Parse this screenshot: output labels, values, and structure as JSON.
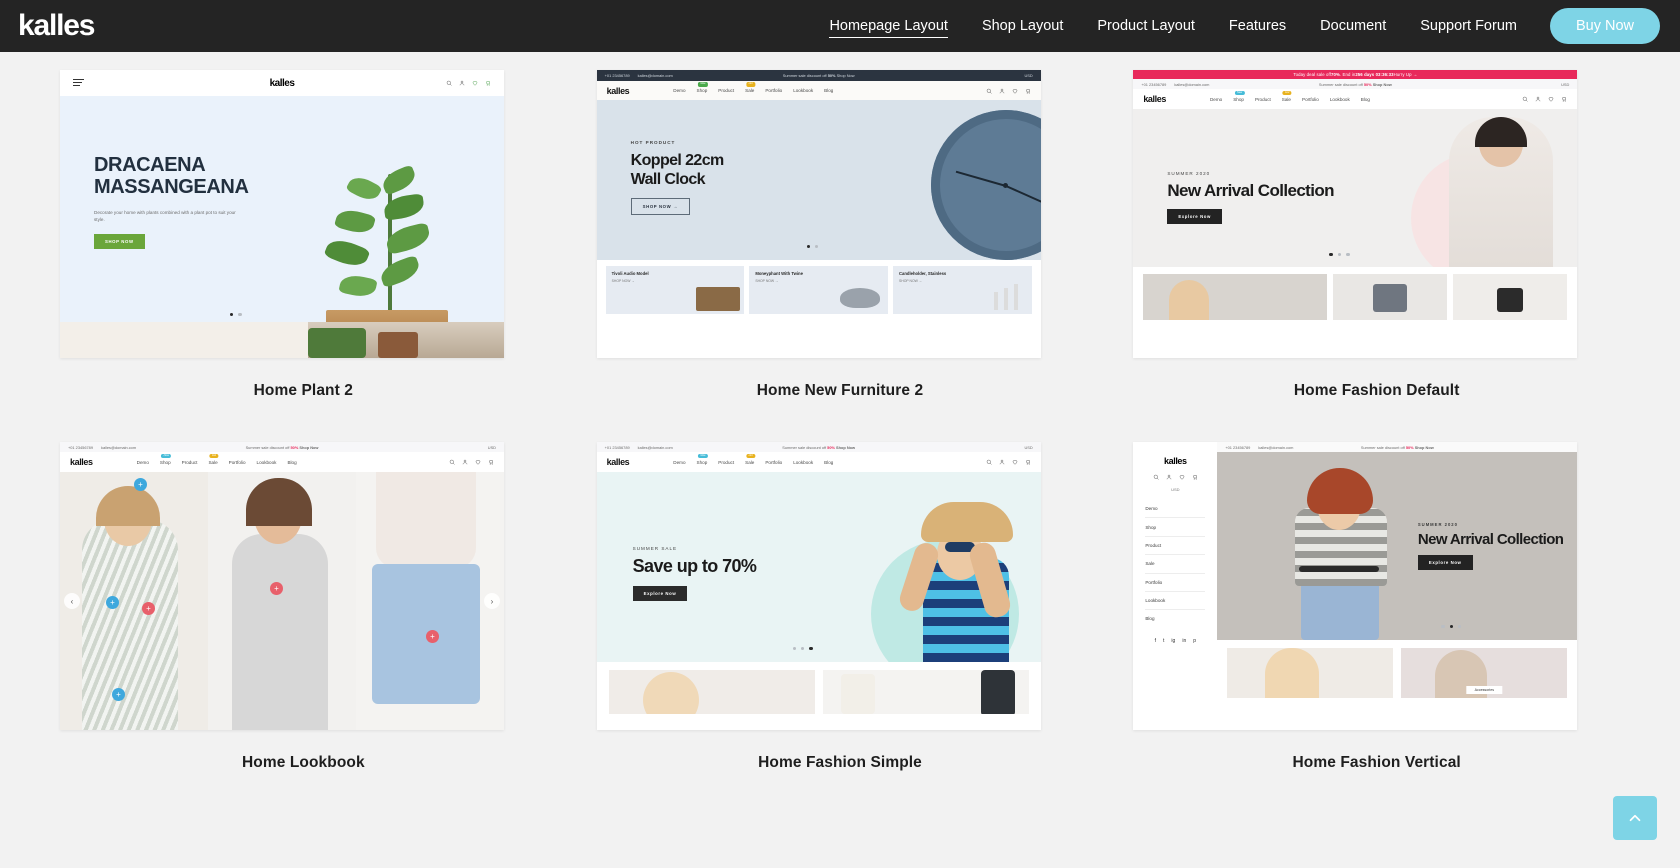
{
  "header": {
    "brand": "kalles",
    "nav": [
      {
        "label": "Homepage Layout",
        "active": true
      },
      {
        "label": "Shop Layout",
        "active": false
      },
      {
        "label": "Product Layout",
        "active": false
      },
      {
        "label": "Features",
        "active": false
      },
      {
        "label": "Document",
        "active": false
      },
      {
        "label": "Support Forum",
        "active": false
      }
    ],
    "cta": "Buy Now",
    "accent_color": "#7ed4e6",
    "bar_color": "#242424"
  },
  "common": {
    "logo": "kalles",
    "phone": "+01 23456789",
    "email": "kalles@domain.com",
    "announcement_prefix": "Summer sale discount off ",
    "announcement_percent": "50%",
    "announcement_suffix": " Shop Now",
    "currency": "USD",
    "nav_items": [
      "Demo",
      "Shop",
      "Product",
      "Sale",
      "Portfolio",
      "Lookbook",
      "Blog"
    ],
    "badge_new": "New",
    "badge_hot": "Hot",
    "social": [
      "f",
      "t",
      "ig",
      "in",
      "p"
    ]
  },
  "cards": [
    {
      "id": "home-plant-2",
      "title": "Home Plant 2",
      "hero": {
        "title_line1": "DRACAENA",
        "title_line2": "MASSANGEANA",
        "subtitle": "Decorate your home with plants combined with a plant pot to suit your style.",
        "button": "SHOP NOW",
        "button_color": "#6aa63a",
        "bg": "#eaf2fb"
      },
      "dots": {
        "count": 2,
        "active": 0
      }
    },
    {
      "id": "home-new-furniture-2",
      "title": "Home New Furniture 2",
      "hero": {
        "eyebrow": "HOT PRODUCT",
        "title_line1": "Koppel 22cm",
        "title_line2": "Wall Clock",
        "button": "SHOP NOW  →",
        "bg": "#d9e2ea"
      },
      "dots": {
        "count": 2,
        "active": 0
      },
      "products": [
        {
          "name": "Tivoli Audio Model",
          "button": "SHOP NOW  →"
        },
        {
          "name": "Moneyphant With Twine",
          "button": "SHOP NOW  →"
        },
        {
          "name": "Candleholder, Stainless",
          "button": "SHOP NOW  →"
        }
      ]
    },
    {
      "id": "home-fashion-default",
      "title": "Home Fashion Default",
      "promo": {
        "text_a": "Today deal sale off ",
        "percent": "70%",
        "text_b": ". End in ",
        "timer": "256 days 03:36:33",
        "text_c": " Hurry Up  →",
        "bg": "#e8295b"
      },
      "hero": {
        "eyebrow": "SUMMER 2020",
        "title_line1": "New Arrival Collection",
        "button": "Explore Now",
        "bg": "#f0efee"
      },
      "dots": {
        "count": 3,
        "active": 0
      }
    },
    {
      "id": "home-lookbook",
      "title": "Home Lookbook",
      "hotspots": [
        {
          "color": "#3ea8dd",
          "symbol": "+"
        },
        {
          "color": "#e8606b",
          "symbol": "+"
        }
      ]
    },
    {
      "id": "home-fashion-simple",
      "title": "Home Fashion Simple",
      "hero": {
        "eyebrow": "SUMMER SALE",
        "title_line1": "Save up to 70%",
        "button": "Explore Now",
        "bg": "#e9f4f4"
      },
      "dots": {
        "count": 3,
        "active": 2
      }
    },
    {
      "id": "home-fashion-vertical",
      "title": "Home Fashion Vertical",
      "hero": {
        "title_line1": "New Arrival Collection",
        "button": "Explore Now",
        "bg": "#c4c0bb"
      },
      "dots": {
        "count": 3,
        "active": 1
      },
      "tiles": [
        {
          "label": ""
        },
        {
          "label": "Accessories"
        }
      ]
    }
  ],
  "scroll_top": {
    "icon": "chevron-up-icon",
    "color": "#7ed4e6"
  }
}
